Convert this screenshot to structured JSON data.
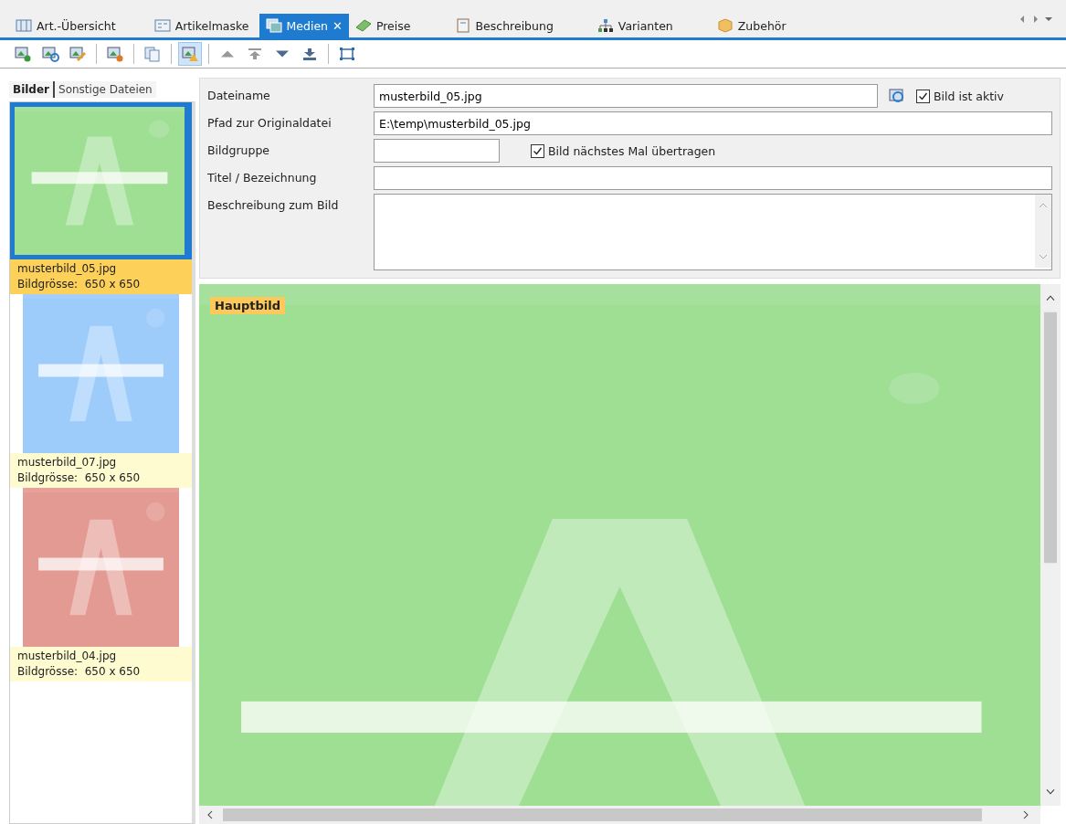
{
  "tabs": [
    {
      "label": "Art.-Übersicht",
      "selected": false
    },
    {
      "label": "Artikelmaske",
      "selected": false
    },
    {
      "label": "Medien",
      "selected": true,
      "close": "✕"
    },
    {
      "label": "Preise",
      "selected": false
    },
    {
      "label": "Beschreibung",
      "selected": false
    },
    {
      "label": "Varianten",
      "selected": false
    },
    {
      "label": "Zubehör",
      "selected": false
    }
  ],
  "toolbar": [
    {
      "kind": "button",
      "active": false
    },
    {
      "kind": "button",
      "active": false
    },
    {
      "kind": "button",
      "active": false
    },
    {
      "kind": "separator"
    },
    {
      "kind": "button",
      "active": false
    },
    {
      "kind": "separator"
    },
    {
      "kind": "button",
      "active": false
    },
    {
      "kind": "separator"
    },
    {
      "kind": "button",
      "active": true
    },
    {
      "kind": "separator"
    },
    {
      "kind": "button",
      "active": false
    },
    {
      "kind": "button",
      "active": false
    },
    {
      "kind": "button",
      "active": false
    },
    {
      "kind": "button",
      "active": false
    },
    {
      "kind": "separator"
    },
    {
      "kind": "button",
      "active": false
    }
  ],
  "subtabs": [
    {
      "label": "Bilder",
      "selected": true
    },
    {
      "label": "Sonstige Dateien",
      "selected": false
    }
  ],
  "thumbnails": [
    {
      "kind": "picture",
      "file": "musterbild_05.jpg",
      "size": "Bildgrösse:  650 x 650",
      "selected": true
    },
    {
      "kind": "picture",
      "file": "musterbild_07.jpg",
      "size": "Bildgrösse:  650 x 650",
      "selected": false
    },
    {
      "kind": "picture",
      "file": "musterbild_04.jpg",
      "size": "Bildgrösse:  650 x 650",
      "selected": false
    }
  ],
  "form": {
    "dateiname": {
      "label": "Dateiname",
      "value": "musterbild_05.jpg"
    },
    "aktiv": {
      "label": "Bild ist aktiv",
      "checked": true
    },
    "pfad": {
      "label": "Pfad zur Originaldatei",
      "value": "E:\\temp\\musterbild_05.jpg"
    },
    "bildgruppe": {
      "label": "Bildgruppe"
    },
    "uebertragen": {
      "label": "Bild nächstes Mal übertragen",
      "checked": true
    },
    "titel": {
      "label": "Titel / Bezeichnung"
    },
    "beschreibung": {
      "label": "Beschreibung zum Bild"
    }
  },
  "preview": {
    "kind": "picture",
    "badge": "Hauptbild"
  }
}
